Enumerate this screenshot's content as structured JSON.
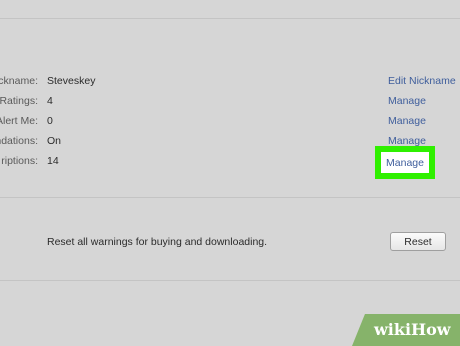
{
  "settings": {
    "rows": [
      {
        "label": "Nickname:",
        "value": "Steveskey",
        "link": "Edit Nickname"
      },
      {
        "label": "Ratings:",
        "value": "4",
        "link": "Manage"
      },
      {
        "label": "Alert Me:",
        "value": "0",
        "link": "Manage"
      },
      {
        "label": "endations:",
        "value": "On",
        "link": "Manage"
      },
      {
        "label": "riptions:",
        "value": "14",
        "link": "Manage"
      }
    ]
  },
  "reset": {
    "description": "Reset all warnings for buying and downloading.",
    "button_label": "Reset"
  },
  "watermark": {
    "wiki": "wiki",
    "how": "How"
  },
  "colors": {
    "highlight": "#2ff000",
    "link": "#3f5e9c",
    "background": "#d6d6d6"
  }
}
